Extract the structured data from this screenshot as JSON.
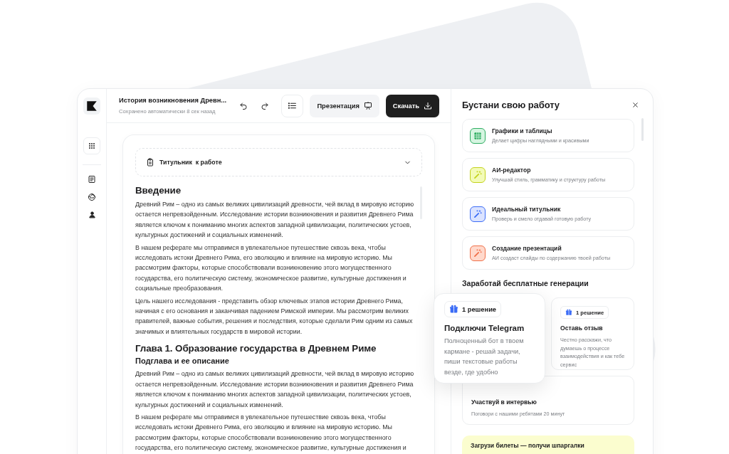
{
  "document": {
    "title": "История возникновения Древн...",
    "save_status": "Сохранено автоматически 8 сек назад"
  },
  "toolbar": {
    "buttons": [
      {
        "kind": "secondary",
        "label": "Презентация"
      },
      {
        "kind": "primary",
        "label": "Скачать"
      }
    ]
  },
  "title_page": {
    "label": "Титульник  к работе",
    "expanded": false
  },
  "content": [
    {
      "kind": "h1",
      "text": "Введение"
    },
    {
      "kind": "p",
      "text": "Древний Рим – одно из самых великих цивилизаций древности, чей вклад в мировую историю остается непревзойденным. Исследование истории возникновения и развития Древнего Рима является ключом к пониманию многих аспектов западной цивилизации, политических устоев, культурных достижений и социальных изменений."
    },
    {
      "kind": "p",
      "text": "В нашем реферате мы отправимся в увлекательное путешествие сквозь века, чтобы исследовать истоки Древнего Рима, его эволюцию и влияние на мировую историю. Мы рассмотрим факторы, которые способствовали возникновению этого могущественного государства, его политическую систему, экономическое развитие, культурные достижения и социальные преобразования."
    },
    {
      "kind": "p",
      "text": "Цель нашего исследования - представить обзор ключевых этапов истории Древнего Рима, начиная с его основания и заканчивая падением Римской империи. Мы рассмотрим великих правителей, важные события, решения и последствия, которые сделали Рим одним из самых значимых и влиятельных государств в мировой истории."
    },
    {
      "kind": "h1",
      "text": "Глава 1. Образование государства в Древнем Риме"
    },
    {
      "kind": "h2",
      "text": "Подглава и ее описание"
    },
    {
      "kind": "p",
      "text": "Древний Рим – одно из самых великих цивилизаций древности, чей вклад в мировую историю остается непревзойденным. Исследование истории возникновения и развития Древнего Рима является ключом к пониманию многих аспектов западной цивилизации, политических устоев, культурных достижений и социальных изменений."
    },
    {
      "kind": "p",
      "text": "В нашем реферате мы отправимся в увлекательное путешествие сквозь века, чтобы исследовать истоки Древнего Рима, его эволюцию и влияние на мировую историю. Мы рассмотрим факторы, которые способствовали возникновению этого могущественного государства, его политическую систему, экономическое развитие, культурные достижения и"
    }
  ],
  "boost_panel": {
    "title": "Бустани свою работу",
    "tools": [
      {
        "kind": "table",
        "color": "#d6f5e1",
        "title": "Графики и таблицы",
        "text": "Делает цифры наглядными и красивыми"
      },
      {
        "kind": "wand",
        "color": "#f3fbb8",
        "title": "АИ-редактор",
        "text": "Улучшай стиль, грамматику и структуру работы"
      },
      {
        "kind": "wand",
        "color": "#dbe3ff",
        "title": "Идеальный титульник",
        "text": "Проверь и смело отдавай готовую работу"
      },
      {
        "kind": "wand",
        "color": "#ffd9cc",
        "title": "Создание презентаций",
        "text": "АИ создаст слайды по содержанию твоей работы"
      }
    ],
    "earn_title": "Заработай бесплатные генерации",
    "featured_task": {
      "badge": "1 решение",
      "title": "Подключи Telegram",
      "text": "Полноценный бот в твоем кармане - решай задачи, пиши текстовые работы везде, где удобно"
    },
    "tasks": [
      {
        "badge": "1 решение",
        "title": "Оставь отзыв",
        "text": "Честно расскажи, что думаешь о процессе взаимодействия и как тебе сервис"
      },
      {
        "title": "Участвуй в интервью",
        "text": "Поговори с нашими ребятами 20 минут"
      }
    ],
    "banner": "Загрузи билеты — получи шпаргалки"
  }
}
